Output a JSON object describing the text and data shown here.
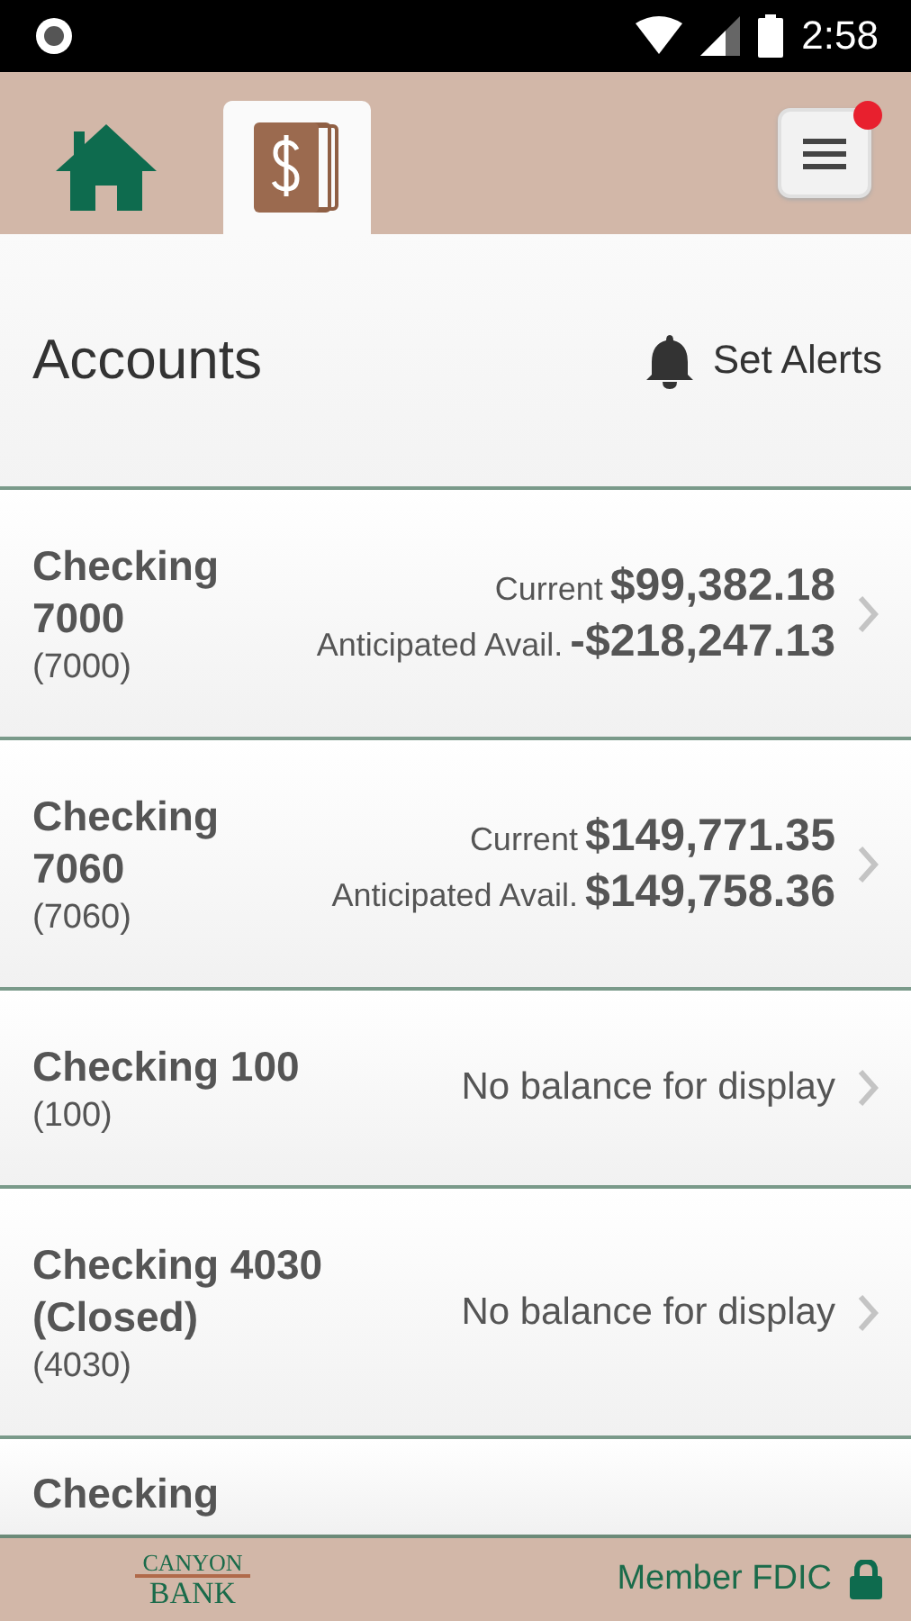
{
  "status_bar": {
    "time": "2:58"
  },
  "nav": {
    "tabs": [
      {
        "kind": "home",
        "selected": false
      },
      {
        "kind": "accounts",
        "selected": true
      }
    ],
    "menu": {
      "notification": true
    }
  },
  "page": {
    "title": "Accounts",
    "alerts_button": "Set Alerts"
  },
  "accounts": [
    {
      "kind": "balances",
      "name": "Checking\n7000",
      "number": "(7000)",
      "current_label": "Current",
      "current": "$99,382.18",
      "avail_label": "Anticipated Avail.",
      "avail": "-$218,247.13"
    },
    {
      "kind": "balances",
      "name": "Checking\n7060",
      "number": "(7060)",
      "current_label": "Current",
      "current": "$149,771.35",
      "avail_label": "Anticipated Avail.",
      "avail": "$149,758.36"
    },
    {
      "kind": "none",
      "name": "Checking 100",
      "number": "(100)",
      "message": "No balance for display"
    },
    {
      "kind": "none",
      "name": "Checking 4030\n(Closed)",
      "number": "(4030)",
      "message": "No balance for display"
    },
    {
      "kind": "partial",
      "name": "Checking"
    }
  ],
  "footer": {
    "logo_top": "CANYON",
    "logo_bottom": "BANK",
    "fdic": "Member FDIC"
  }
}
